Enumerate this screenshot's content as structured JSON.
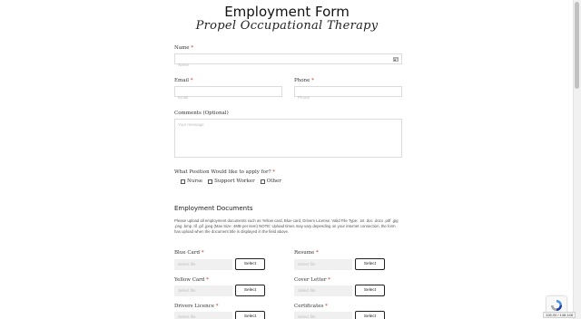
{
  "header": {
    "title": "Employment Form",
    "subtitle": "Propel Occupational Therapy"
  },
  "fields": {
    "name": {
      "label": "Name",
      "required": "*",
      "placeholder": "Name",
      "icon": "contact-card-icon"
    },
    "email": {
      "label": "Email",
      "required": "*",
      "placeholder": "Email"
    },
    "phone": {
      "label": "Phone",
      "required": "*",
      "placeholder": "Phone"
    },
    "comments": {
      "label": "Comments (Optional)",
      "placeholder": "Your message"
    }
  },
  "position": {
    "label": "What Position Would like to apply for?",
    "required": "*",
    "options": [
      "Nurse",
      "Support Worker",
      "Other"
    ]
  },
  "documents": {
    "title": "Employment Documents",
    "notice": "Please upload all employment documents such as Yellow card, Blue card, Drivers License. Valid File Type: .txt .doc .docx .pdf .jpg .png .bmp .tif .gif .jpeg (Max Size: 4MB per item) NOTE: Upload times may vary depending on your internet connection, the form has upload when the document title is displayed in the field above.",
    "select_label": "Select",
    "file_placeholder": "Select file",
    "items": [
      {
        "label": "Blue Card",
        "required": "*"
      },
      {
        "label": "Resume",
        "required": "*"
      },
      {
        "label": "Yellow Card",
        "required": "*"
      },
      {
        "label": "Cover Letter",
        "required": "*"
      },
      {
        "label": "Drivers Licence",
        "required": "*"
      },
      {
        "label": "Certificates",
        "required": "*"
      }
    ]
  },
  "status_bar": {
    "text": "128.00 / 148.148"
  }
}
